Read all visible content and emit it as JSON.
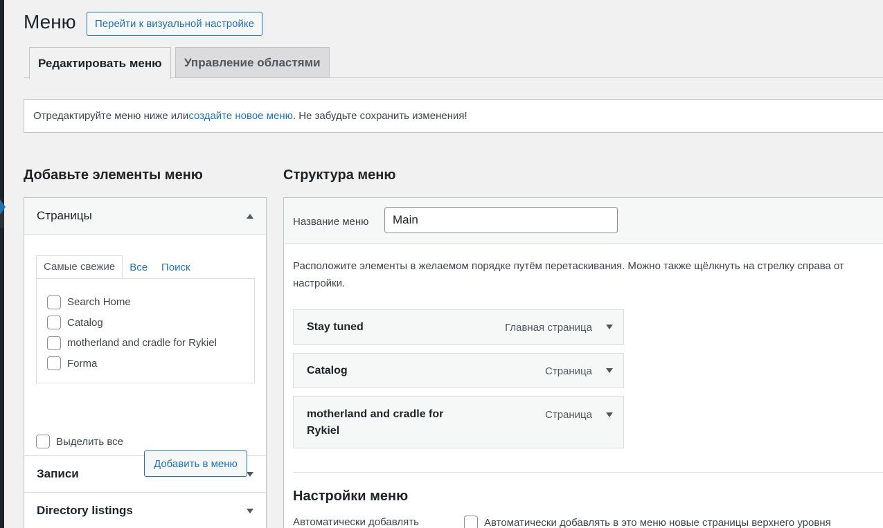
{
  "header": {
    "title": "Меню",
    "visual_button": "Перейти к визуальной настройке"
  },
  "tabs": [
    {
      "label": "Редактировать меню",
      "active": true
    },
    {
      "label": "Управление областями",
      "active": false
    }
  ],
  "notice": {
    "before": "Отредактируйте меню ниже или ",
    "link": "создайте новое меню",
    "after": ". Не забудьте сохранить изменения!"
  },
  "left": {
    "title": "Добавьте элементы меню",
    "pages": {
      "label": "Страницы",
      "tabs": [
        "Самые свежие",
        "Все",
        "Поиск"
      ],
      "items": [
        "Search Home",
        "Catalog",
        "motherland and cradle for Rykiel",
        "Forma"
      ],
      "select_all": "Выделить все",
      "add_button": "Добавить в меню"
    },
    "sections": [
      "Записи",
      "Directory listings"
    ]
  },
  "right": {
    "title": "Структура меню",
    "menu_name_label": "Название меню",
    "menu_name_value": "Main",
    "instructions_line1": "Расположите элементы в желаемом порядке путём перетаскивания. Можно также щёлкнуть на стрелку справа от",
    "instructions_line2": "настройки.",
    "items": [
      {
        "title": "Stay tuned",
        "type": "Главная страница"
      },
      {
        "title": "Catalog",
        "type": "Страница"
      },
      {
        "title_line1": "motherland and cradle for",
        "title_line2": "Rykiel",
        "type": "Страница"
      }
    ],
    "settings_title": "Настройки меню",
    "auto_add_label": "Автоматически добавлять",
    "auto_add_text": "Автоматически добавлять в это меню новые страницы верхнего уровня"
  },
  "colors": {
    "accent": "#2271b1",
    "rail": "#1d2327",
    "background": "#f1f1f1"
  }
}
